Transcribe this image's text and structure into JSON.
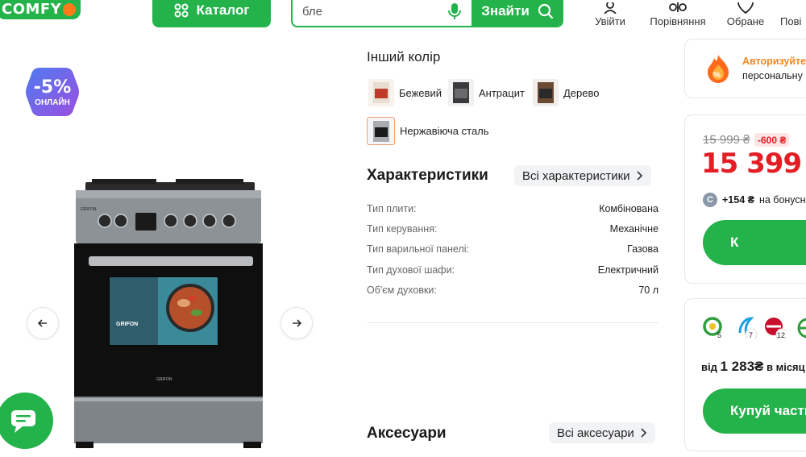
{
  "header": {
    "logo": "COMFY",
    "catalog_label": "Каталог",
    "search_value": "бле",
    "search_button": "Знайти",
    "nav": [
      {
        "label": "Увійти",
        "icon": "user-icon"
      },
      {
        "label": "Порівняння",
        "icon": "scales-icon"
      },
      {
        "label": "Обране",
        "icon": "heart-icon"
      },
      {
        "label": "Пові",
        "icon": "bell-icon"
      }
    ]
  },
  "gallery": {
    "badge_percent": "-5%",
    "badge_caption": "ОНЛАЙН",
    "brand": "GRIFON",
    "prev_icon": "arrow-left-icon",
    "next_icon": "arrow-right-icon",
    "chat_icon": "chat-icon"
  },
  "colors": {
    "title": "Інший колір",
    "options": [
      {
        "label": "Бежевий",
        "swatch": "#e8ddd0",
        "selected": false
      },
      {
        "label": "Антрацит",
        "swatch": "#3a3a3c",
        "selected": false
      },
      {
        "label": "Дерево",
        "swatch": "#6b4a34",
        "selected": false
      },
      {
        "label": "Нержавіюча сталь",
        "swatch": "#b8bcc0",
        "selected": true
      }
    ]
  },
  "specs": {
    "title": "Характеристики",
    "all_link": "Всі характеристики",
    "rows": [
      {
        "label": "Тип плити:",
        "value": "Комбінована"
      },
      {
        "label": "Тип керування:",
        "value": "Механічне"
      },
      {
        "label": "Тип варильної панелі:",
        "value": "Газова"
      },
      {
        "label": "Тип духової шафи:",
        "value": "Електричний"
      },
      {
        "label": "Об'єм духовки:",
        "value": "70 л"
      }
    ]
  },
  "accessories": {
    "title": "Аксесуари",
    "all_link": "Всі аксесуари"
  },
  "auth_card": {
    "line1": "Авторизуйтеся",
    "line2": "персональну ц"
  },
  "price_card": {
    "old_price": "15 999 ₴",
    "discount": "-600 ₴",
    "price": "15 399",
    "currency": "₴",
    "bonus_amount": "+154 ₴",
    "bonus_text": "на бонусни",
    "button_label": "К"
  },
  "credit_card": {
    "banks": [
      {
        "count": "5",
        "color": "#2e9e3e"
      },
      {
        "count": "7",
        "color": "#1a9fe0"
      },
      {
        "count": "12",
        "color": "#c8102e"
      },
      {
        "count": "",
        "color": "#2e9e3e"
      }
    ],
    "from_label": "від",
    "monthly": "1 283",
    "currency": "₴",
    "per_month": "в місяц",
    "button_label": "Купуй части"
  }
}
